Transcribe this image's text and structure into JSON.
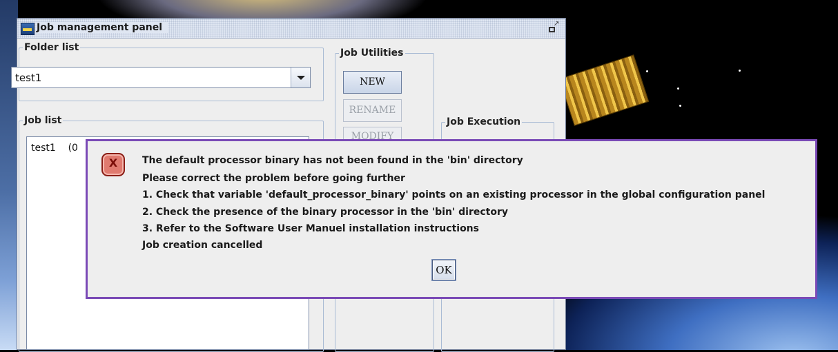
{
  "window": {
    "title": "Job management panel"
  },
  "folder_list": {
    "legend": "Folder list",
    "selected": "test1"
  },
  "job_list": {
    "legend": "Job list",
    "items": [
      "test1    (0"
    ]
  },
  "job_utilities": {
    "legend": "Job Utilities",
    "new_label": "NEW",
    "rename_label": "RENAME",
    "modify_label": "MODIFY"
  },
  "job_execution": {
    "legend": "Job Execution"
  },
  "dialog": {
    "lines": [
      "The default processor binary has not been found in the 'bin' directory",
      "Please correct the problem before going further",
      "1. Check that variable 'default_processor_binary' points on an existing processor in the global configuration panel",
      "2. Check the presence of the binary processor in the 'bin' directory",
      "3. Refer to the Software User Manuel installation instructions",
      "Job creation cancelled"
    ],
    "ok_label": "OK",
    "icon_glyph": "X"
  },
  "colors": {
    "dialog_border": "#7a4ab6",
    "error_icon": "#e07a6f"
  }
}
